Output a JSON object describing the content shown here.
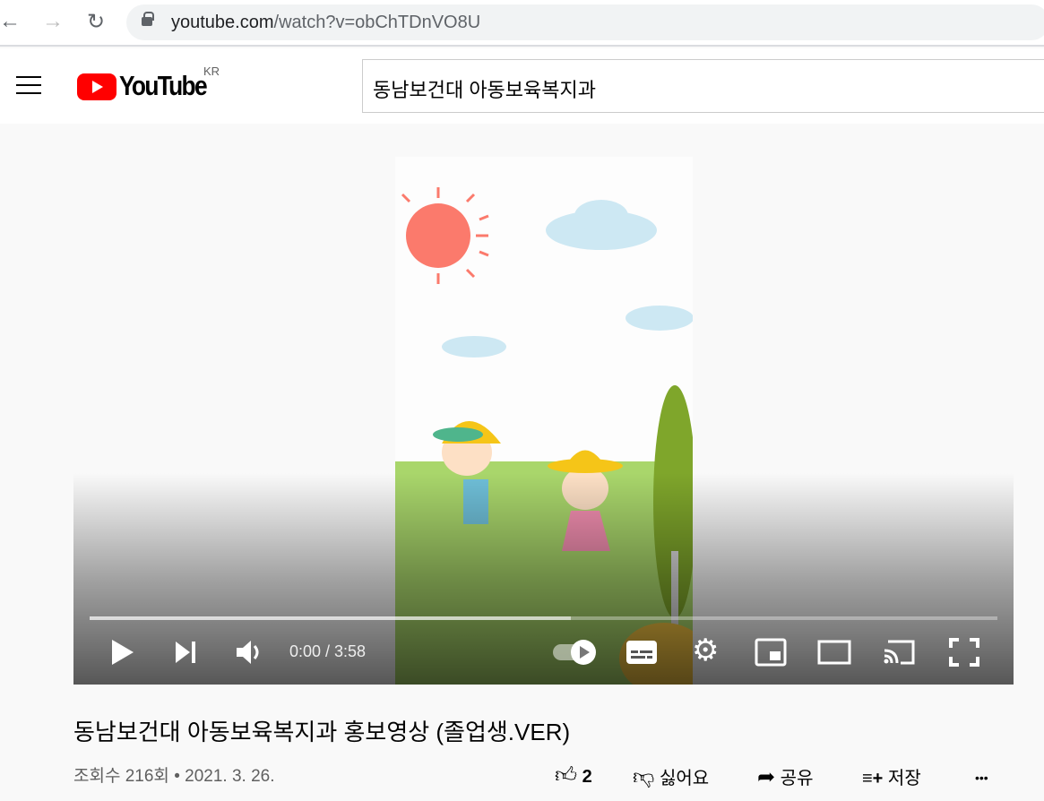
{
  "browser": {
    "url_host": "youtube.com",
    "url_path": "/watch?v=obChTDnVO8U"
  },
  "header": {
    "logo": "YouTube",
    "region": "KR",
    "search_value": "동남보건대 아동보육복지과"
  },
  "player": {
    "time": "0:00 / 3:58",
    "progress_buffered_fraction": 0.53,
    "autoplay": true
  },
  "video": {
    "title": "동남보건대 아동보육복지과 홍보영상 (졸업생.VER)",
    "views": "조회수 216회",
    "dot": "•",
    "date": "2021. 3. 26."
  },
  "actions": {
    "likes": "2",
    "dislike": "싫어요",
    "share": "공유",
    "save": "저장",
    "more": "•••"
  }
}
